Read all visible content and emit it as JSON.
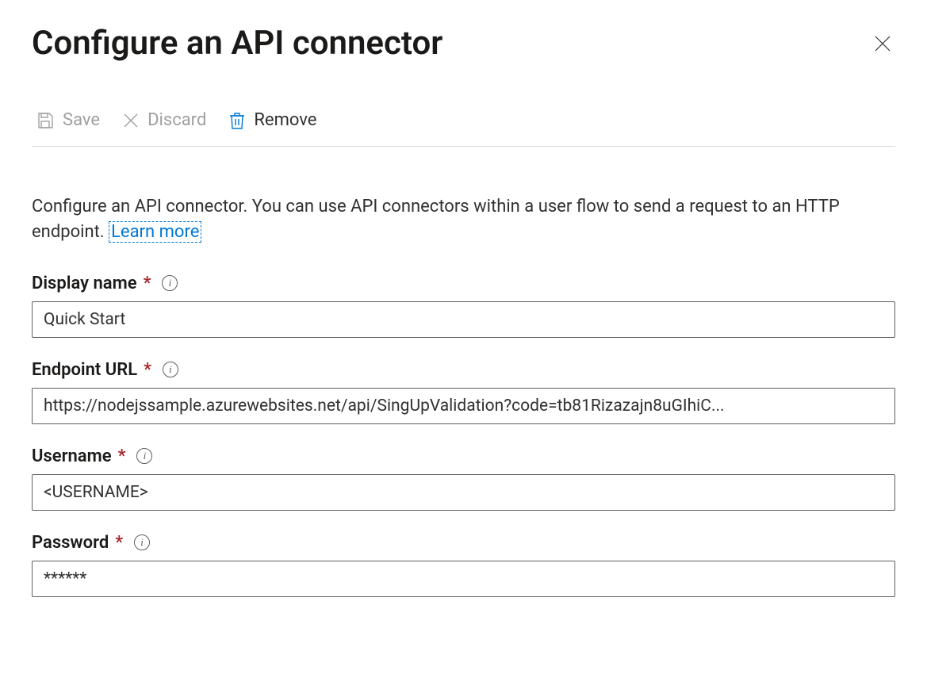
{
  "header": {
    "title": "Configure an API connector"
  },
  "toolbar": {
    "save_label": "Save",
    "discard_label": "Discard",
    "remove_label": "Remove"
  },
  "description": {
    "text": "Configure an API connector. You can use API connectors within a user flow to send a request to an HTTP endpoint. ",
    "link_label": "Learn more"
  },
  "fields": {
    "display_name": {
      "label": "Display name",
      "value": "Quick Start"
    },
    "endpoint_url": {
      "label": "Endpoint URL",
      "value": "https://nodejssample.azurewebsites.net/api/SingUpValidation?code=tb81Rizazajn8uGIhiC..."
    },
    "username": {
      "label": "Username",
      "value": "<USERNAME>"
    },
    "password": {
      "label": "Password",
      "value": "******"
    }
  }
}
